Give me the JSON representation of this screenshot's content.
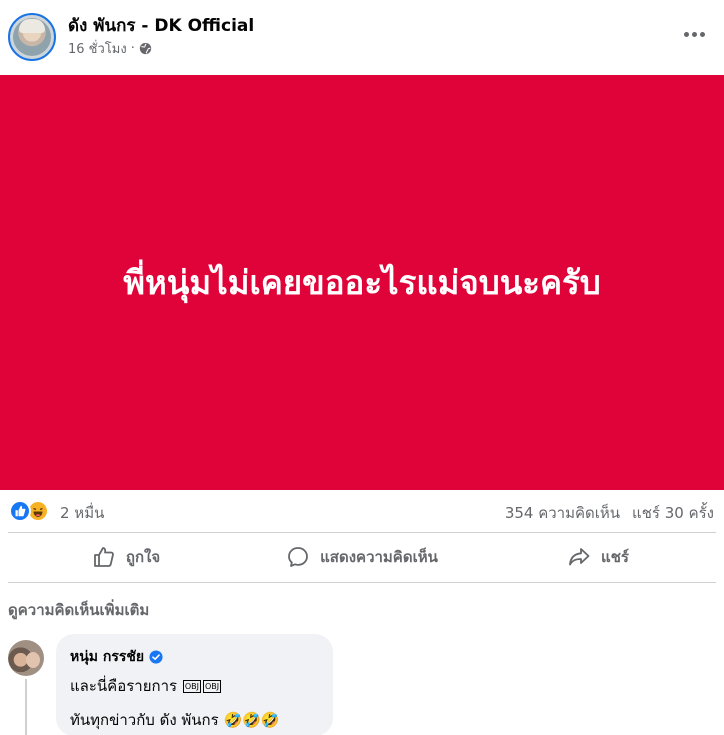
{
  "post": {
    "page_name": "ดัง พันกร - DK Official",
    "time": "16 ชั่วโมง",
    "separator": "·",
    "image_text": "พี่หนุ่มไม่เคยขออะไรแม่จบนะครับ"
  },
  "stats": {
    "reactions": "2 หมื่น",
    "comments": "354 ความคิดเห็น",
    "shares": "แชร์ 30 ครั้ง"
  },
  "actions": {
    "like": "ถูกใจ",
    "comment": "แสดงความคิดเห็น",
    "share": "แชร์"
  },
  "comments_section": {
    "view_more": "ดูความคิดเห็นเพิ่มเติม",
    "items": [
      {
        "author": "หนุ่ม กรรชัย",
        "line1": "และนี่คือรายการ",
        "obj_1": "OBJ",
        "obj_2": "OBJ",
        "line2": "ทันทุกข่าวกับ ดัง พันกร",
        "emoji": "🤣🤣🤣"
      }
    ]
  },
  "icons": {
    "globe": "globe-icon",
    "like": "like-icon",
    "haha": "haha-reaction-icon",
    "comment": "comment-icon",
    "share": "share-icon",
    "verified": "verified-badge-icon"
  },
  "colors": {
    "image_bg": "#e0033a",
    "facebook_blue": "#1877f2",
    "secondary_text": "#65676b"
  }
}
